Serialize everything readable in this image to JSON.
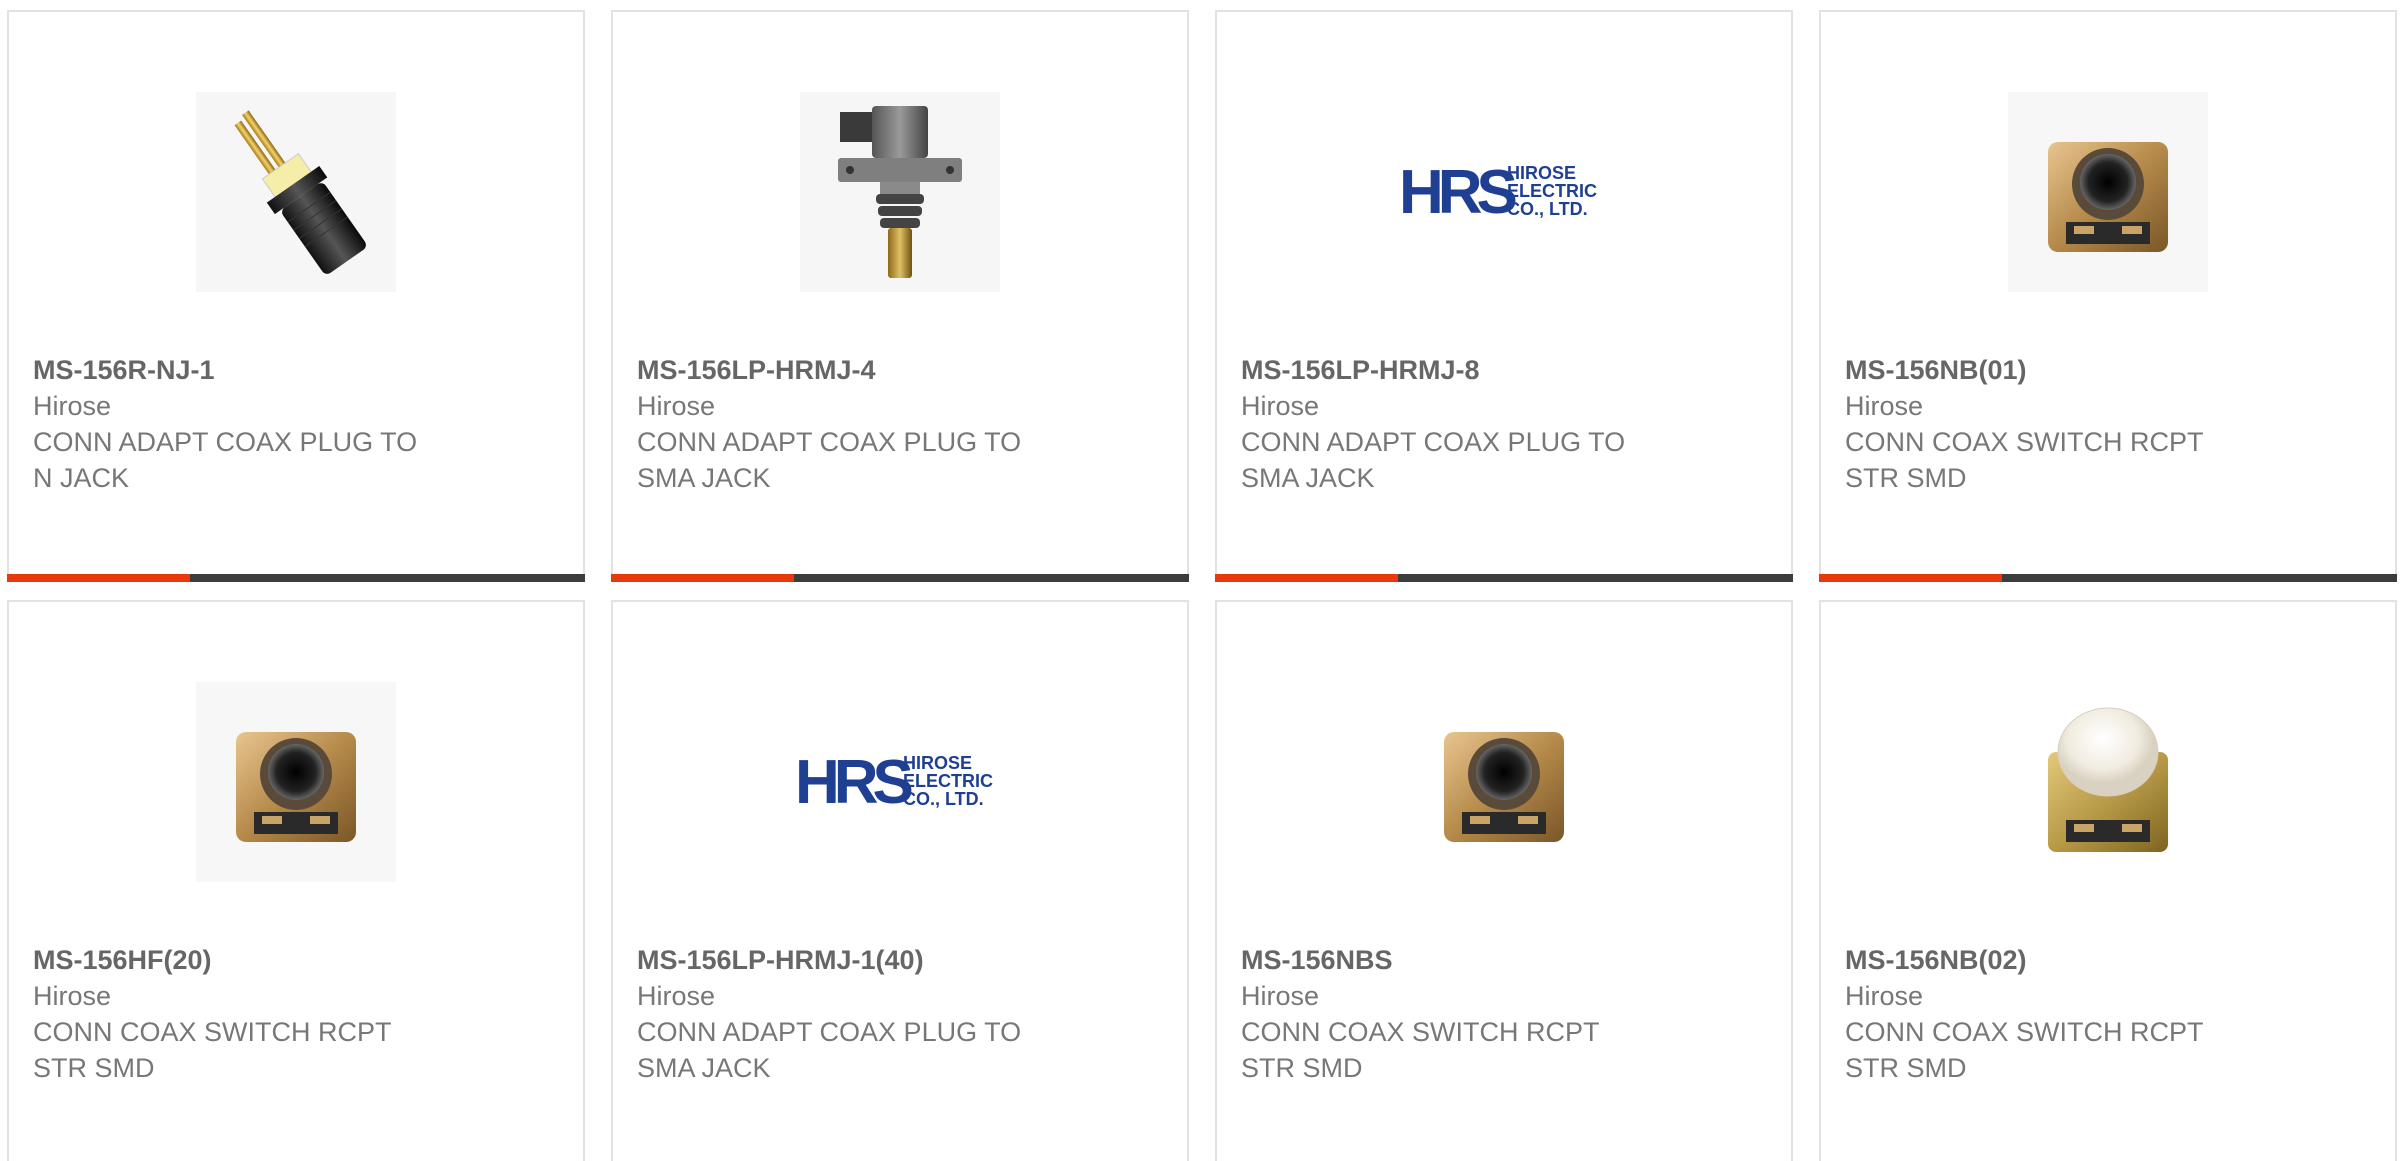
{
  "products": [
    {
      "part_number": "MS-156R-NJ-1",
      "manufacturer": "Hirose",
      "desc_line1": "CONN ADAPT COAX PLUG TO",
      "desc_line2": "N JACK",
      "image": "black-n-adapter-image"
    },
    {
      "part_number": "MS-156LP-HRMJ-4",
      "manufacturer": "Hirose",
      "desc_line1": "CONN ADAPT COAX PLUG TO",
      "desc_line2": "SMA JACK",
      "image": "sma-probe-adapter-image"
    },
    {
      "part_number": "MS-156LP-HRMJ-8",
      "manufacturer": "Hirose",
      "desc_line1": "CONN ADAPT COAX PLUG TO",
      "desc_line2": "SMA JACK",
      "image": "hirose-logo",
      "logo_mark": "HRS",
      "logo_line1": "HIROSE",
      "logo_line2": "ELECTRIC",
      "logo_line3": "CO., LTD."
    },
    {
      "part_number": "MS-156NB(01)",
      "manufacturer": "Hirose",
      "desc_line1": "CONN COAX SWITCH RCPT",
      "desc_line2": "STR SMD",
      "image": "smd-switch-image"
    },
    {
      "part_number": "MS-156HF(20)",
      "manufacturer": "Hirose",
      "desc_line1": "CONN COAX SWITCH RCPT",
      "desc_line2": "STR SMD",
      "image": "smd-switch-image"
    },
    {
      "part_number": "MS-156LP-HRMJ-1(40)",
      "manufacturer": "Hirose",
      "desc_line1": "CONN ADAPT COAX PLUG TO",
      "desc_line2": "SMA JACK",
      "image": "hirose-logo",
      "logo_mark": "HRS",
      "logo_line1": "HIROSE",
      "logo_line2": "ELECTRIC",
      "logo_line3": "CO., LTD."
    },
    {
      "part_number": "MS-156NBS",
      "manufacturer": "Hirose",
      "desc_line1": "CONN COAX SWITCH RCPT",
      "desc_line2": "STR SMD",
      "image": "smd-switch-image"
    },
    {
      "part_number": "MS-156NB(02)",
      "manufacturer": "Hirose",
      "desc_line1": "CONN COAX SWITCH RCPT",
      "desc_line2": "STR SMD",
      "image": "smd-switch-capped-image"
    }
  ],
  "colors": {
    "accent": "#e8380d",
    "bar": "#3c3c3c",
    "logo_blue": "#1f3f93"
  }
}
